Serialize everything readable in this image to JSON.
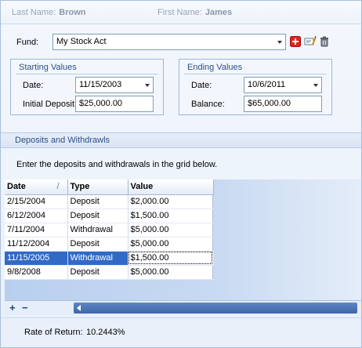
{
  "header": {
    "last_name_label": "Last Name:",
    "last_name_value": "Brown",
    "first_name_label": "First Name:",
    "first_name_value": "James"
  },
  "fund": {
    "label": "Fund:",
    "value": "My Stock Act",
    "icons": [
      "add-icon",
      "edit-icon",
      "delete-icon"
    ]
  },
  "starting": {
    "title": "Starting Values",
    "date_label": "Date:",
    "date_value": "11/15/2003",
    "deposit_label": "Initial Deposit:",
    "deposit_value": "$25,000.00"
  },
  "ending": {
    "title": "Ending Values",
    "date_label": "Date:",
    "date_value": "10/6/2011",
    "balance_label": "Balance:",
    "balance_value": "$65,000.00"
  },
  "section": {
    "title": "Deposits and Withdrawls",
    "instructions": "Enter the deposits and withdrawals in the grid below."
  },
  "grid": {
    "columns": [
      "Date",
      "Type",
      "Value"
    ],
    "sort_glyph": "/",
    "rows": [
      {
        "date": "2/15/2004",
        "type": "Deposit",
        "value": "$2,000.00"
      },
      {
        "date": "6/12/2004",
        "type": "Deposit",
        "value": "$1,500.00"
      },
      {
        "date": "7/11/2004",
        "type": "Withdrawal",
        "value": "$5,000.00"
      },
      {
        "date": "11/12/2004",
        "type": "Deposit",
        "value": "$5,000.00"
      },
      {
        "date": "11/15/2005",
        "type": "Withdrawal",
        "value": "$1,500.00"
      },
      {
        "date": "9/8/2008",
        "type": "Deposit",
        "value": "$5,000.00"
      }
    ],
    "selected_row": 4
  },
  "navigator": {
    "add": "+",
    "remove": "−"
  },
  "footer": {
    "rate_label": "Rate of Return:",
    "rate_value": "10.2443%"
  },
  "colors": {
    "accent": "#2d4f85",
    "selection": "#3169c6",
    "add_icon": "#e2231a"
  }
}
